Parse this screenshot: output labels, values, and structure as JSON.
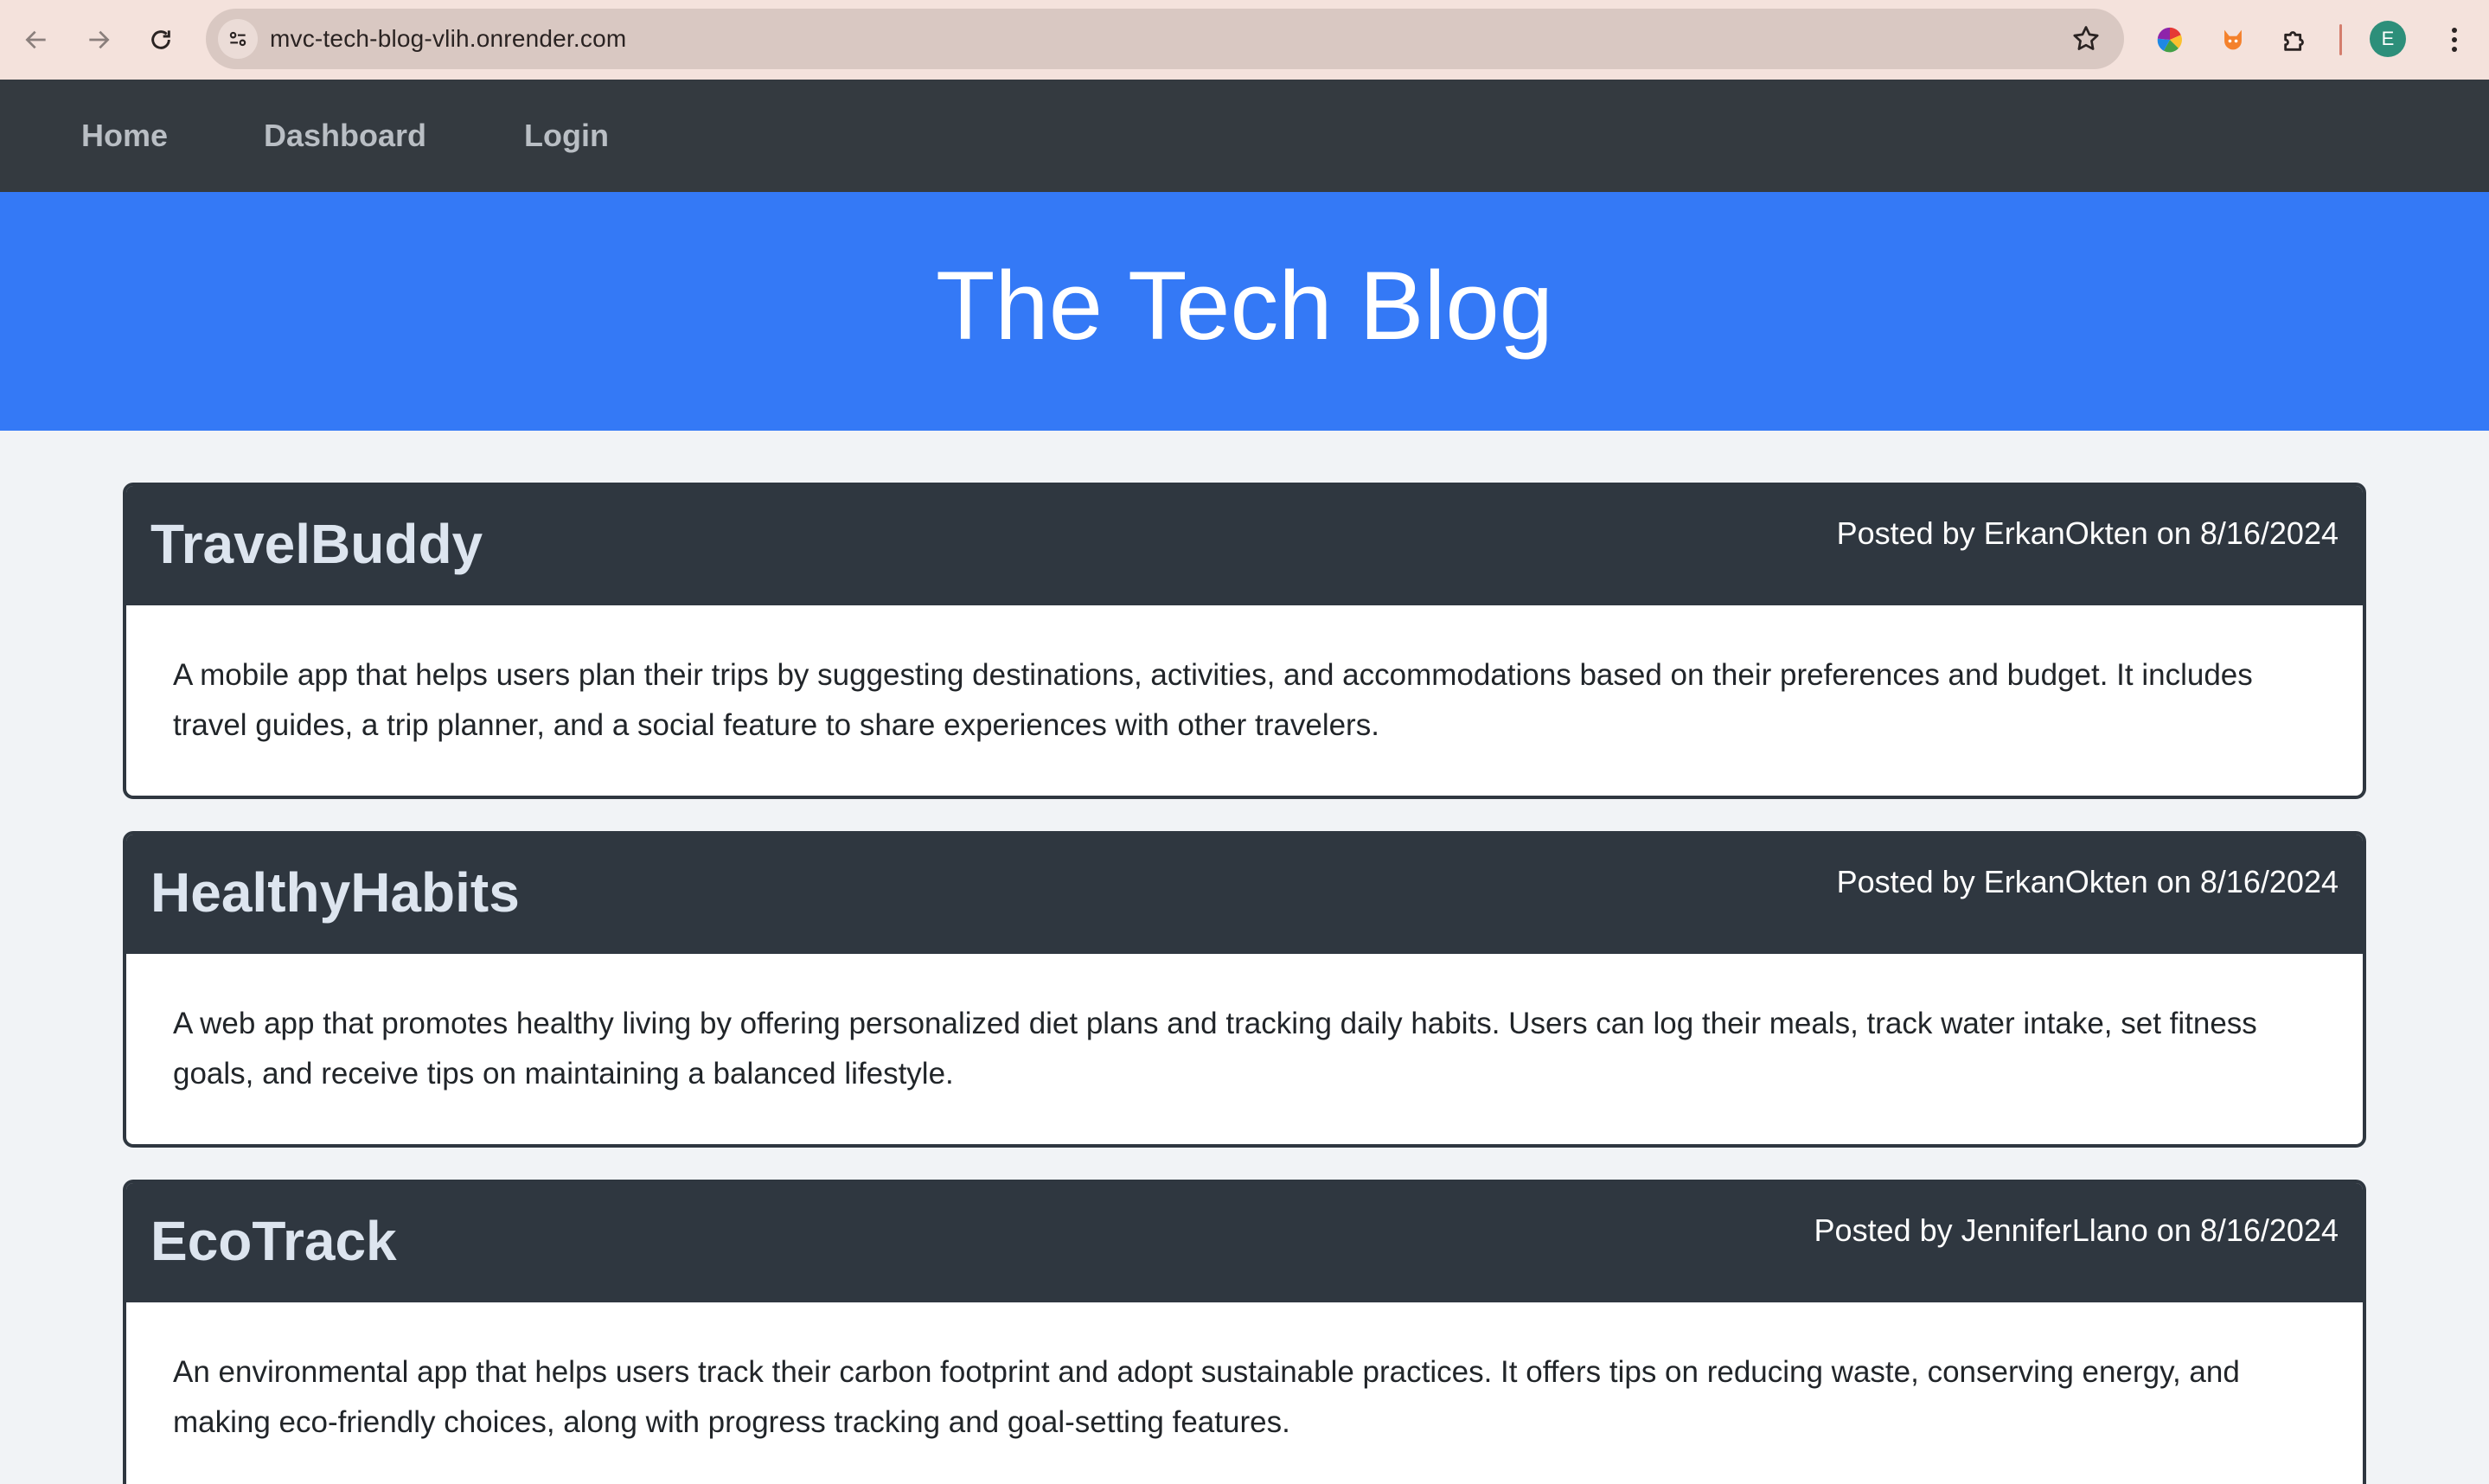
{
  "browser": {
    "url": "mvc-tech-blog-vlih.onrender.com",
    "profile_initial": "E",
    "accent": "#3479f6"
  },
  "nav": {
    "home": "Home",
    "dashboard": "Dashboard",
    "login": "Login"
  },
  "hero": {
    "title": "The Tech Blog"
  },
  "posts": [
    {
      "title": "TravelBuddy",
      "meta": "Posted by ErkanOkten on 8/16/2024",
      "body": "A mobile app that helps users plan their trips by suggesting destinations, activities, and accommodations based on their preferences and budget. It includes travel guides, a trip planner, and a social feature to share experiences with other travelers."
    },
    {
      "title": "HealthyHabits",
      "meta": "Posted by ErkanOkten on 8/16/2024",
      "body": "A web app that promotes healthy living by offering personalized diet plans and tracking daily habits. Users can log their meals, track water intake, set fitness goals, and receive tips on maintaining a balanced lifestyle."
    },
    {
      "title": "EcoTrack",
      "meta": "Posted by JenniferLlano on 8/16/2024",
      "body": "An environmental app that helps users track their carbon footprint and adopt sustainable practices. It offers tips on reducing waste, conserving energy, and making eco-friendly choices, along with progress tracking and goal-setting features."
    }
  ]
}
